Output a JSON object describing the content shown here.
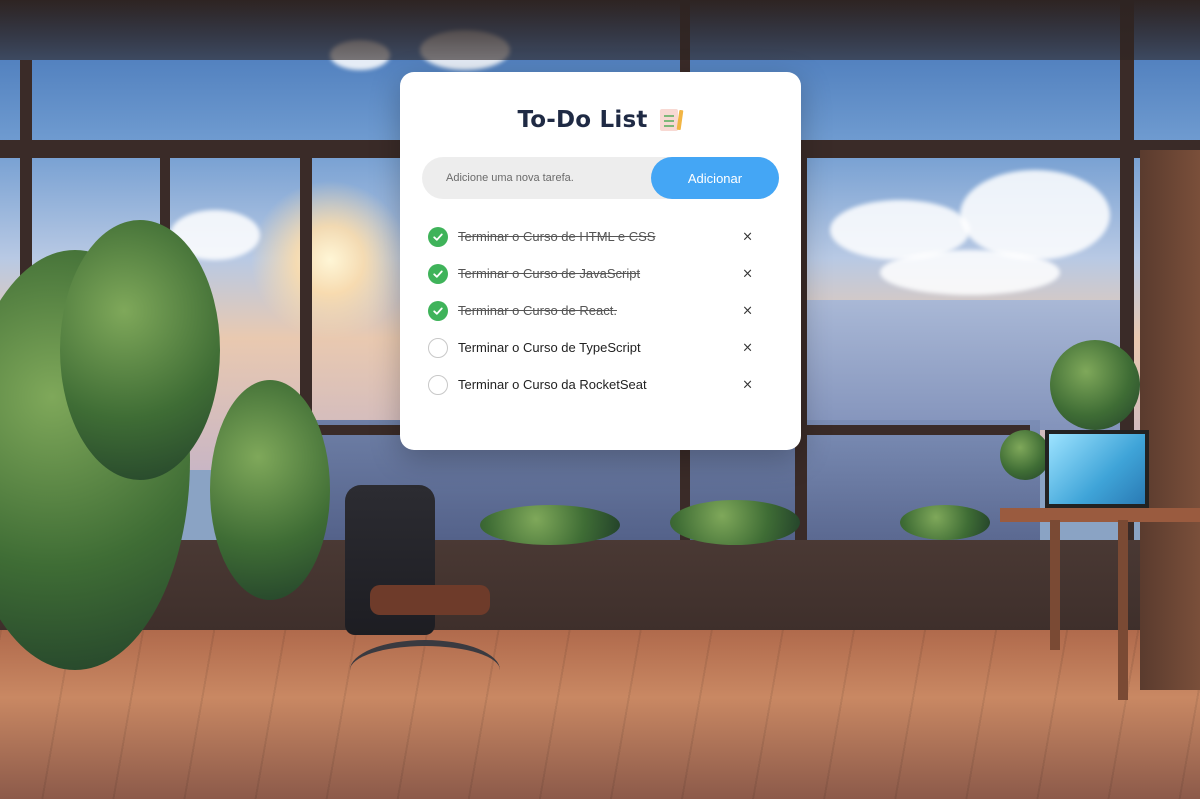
{
  "app": {
    "title": "To-Do List",
    "title_icon": "memo-icon"
  },
  "input": {
    "placeholder": "Adicione uma nova tarefa.",
    "value": ""
  },
  "add_button": {
    "label": "Adicionar"
  },
  "colors": {
    "accent": "#44a6f5",
    "done": "#3fb35a",
    "card": "#ffffff",
    "title": "#1f2a44"
  },
  "tasks": [
    {
      "label": "Terminar o Curso de HTML e CSS",
      "done": true,
      "delete_glyph": "×"
    },
    {
      "label": "Terminar o Curso de JavaScript",
      "done": true,
      "delete_glyph": "×"
    },
    {
      "label": "Terminar o Curso de React.",
      "done": true,
      "delete_glyph": "×"
    },
    {
      "label": "Terminar o Curso de TypeScript",
      "done": false,
      "delete_glyph": "×"
    },
    {
      "label": "Terminar o Curso da RocketSeat",
      "done": false,
      "delete_glyph": "×"
    }
  ]
}
